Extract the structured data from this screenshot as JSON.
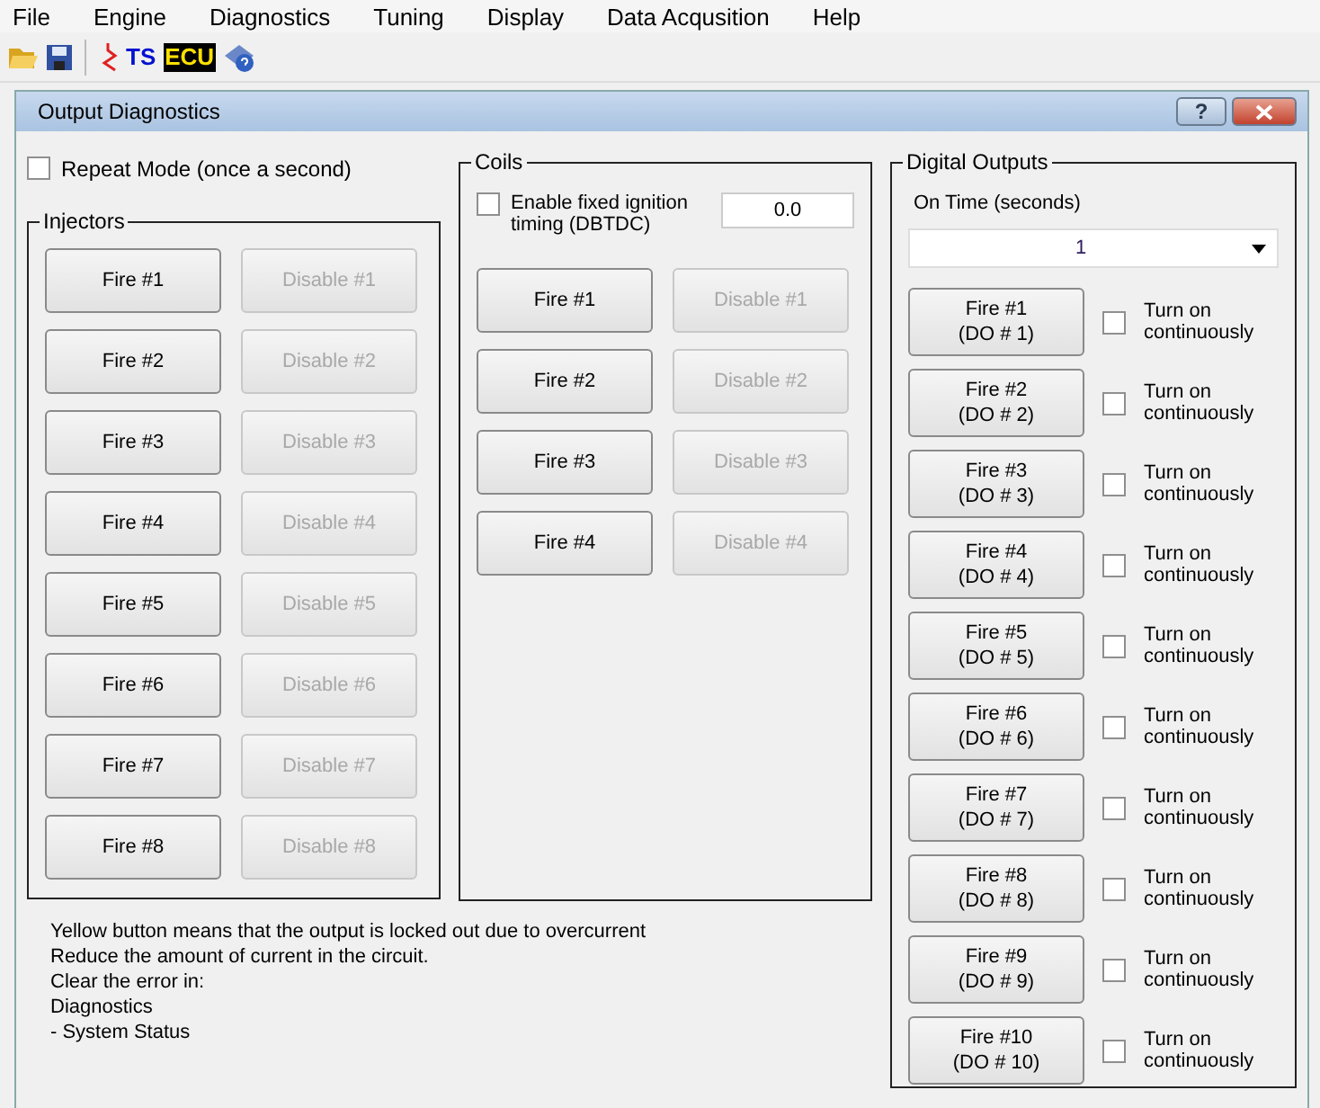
{
  "menu": [
    "File",
    "Engine",
    "Diagnostics",
    "Tuning",
    "Display",
    "Data Acqusition",
    "Help"
  ],
  "toolbar": [
    {
      "kind": "open"
    },
    {
      "kind": "save"
    },
    {
      "kind": "separator"
    },
    {
      "kind": "wave"
    },
    {
      "kind": "text",
      "label": "TS"
    },
    {
      "kind": "ecu",
      "label": "ECU"
    },
    {
      "kind": "help"
    }
  ],
  "dialog": {
    "title": "Output Diagnostics",
    "help_button": "?"
  },
  "repeat_mode": {
    "label": "Repeat Mode (once a second)",
    "checked": false
  },
  "injectors": {
    "title": "Injectors",
    "rows": [
      {
        "fire": "Fire #1",
        "disable": "Disable #1",
        "disable_disabled": true
      },
      {
        "fire": "Fire #2",
        "disable": "Disable #2",
        "disable_disabled": true
      },
      {
        "fire": "Fire #3",
        "disable": "Disable #3",
        "disable_disabled": true
      },
      {
        "fire": "Fire #4",
        "disable": "Disable #4",
        "disable_disabled": true
      },
      {
        "fire": "Fire #5",
        "disable": "Disable #5",
        "disable_disabled": true
      },
      {
        "fire": "Fire #6",
        "disable": "Disable #6",
        "disable_disabled": true
      },
      {
        "fire": "Fire #7",
        "disable": "Disable #7",
        "disable_disabled": true
      },
      {
        "fire": "Fire #8",
        "disable": "Disable #8",
        "disable_disabled": true
      }
    ]
  },
  "coils": {
    "title": "Coils",
    "fixed_timing": {
      "label": "Enable fixed ignition timing (DBTDC)",
      "checked": false,
      "value": "0.0"
    },
    "rows": [
      {
        "fire": "Fire #1",
        "disable": "Disable #1",
        "disable_disabled": true
      },
      {
        "fire": "Fire #2",
        "disable": "Disable #2",
        "disable_disabled": true
      },
      {
        "fire": "Fire #3",
        "disable": "Disable #3",
        "disable_disabled": true
      },
      {
        "fire": "Fire #4",
        "disable": "Disable #4",
        "disable_disabled": true
      }
    ]
  },
  "digital_outputs": {
    "title": "Digital Outputs",
    "on_time_label": "On Time (seconds)",
    "on_time_value": "1",
    "outputs": [
      {
        "fire": "Fire #1",
        "channel": "(DO # 1)",
        "toggle": "Turn on continuously",
        "checked": false
      },
      {
        "fire": "Fire #2",
        "channel": "(DO # 2)",
        "toggle": "Turn on continuously",
        "checked": false
      },
      {
        "fire": "Fire #3",
        "channel": "(DO # 3)",
        "toggle": "Turn on continuously",
        "checked": false
      },
      {
        "fire": "Fire #4",
        "channel": "(DO # 4)",
        "toggle": "Turn on continuously",
        "checked": false
      },
      {
        "fire": "Fire #5",
        "channel": "(DO # 5)",
        "toggle": "Turn on continuously",
        "checked": false
      },
      {
        "fire": "Fire #6",
        "channel": "(DO # 6)",
        "toggle": "Turn on continuously",
        "checked": false
      },
      {
        "fire": "Fire #7",
        "channel": "(DO # 7)",
        "toggle": "Turn on continuously",
        "checked": false
      },
      {
        "fire": "Fire #8",
        "channel": "(DO # 8)",
        "toggle": "Turn on continuously",
        "checked": false
      },
      {
        "fire": "Fire #9",
        "channel": "(DO # 9)",
        "toggle": "Turn on continuously",
        "checked": false
      },
      {
        "fire": "Fire #10",
        "channel": "(DO # 10)",
        "toggle": "Turn on continuously",
        "checked": false
      }
    ]
  },
  "notes": [
    "Yellow button means that the output is locked out due to overcurrent",
    "Reduce the amount of current in the circuit.",
    "Clear the error in:",
    "Diagnostics",
    "- System Status"
  ]
}
